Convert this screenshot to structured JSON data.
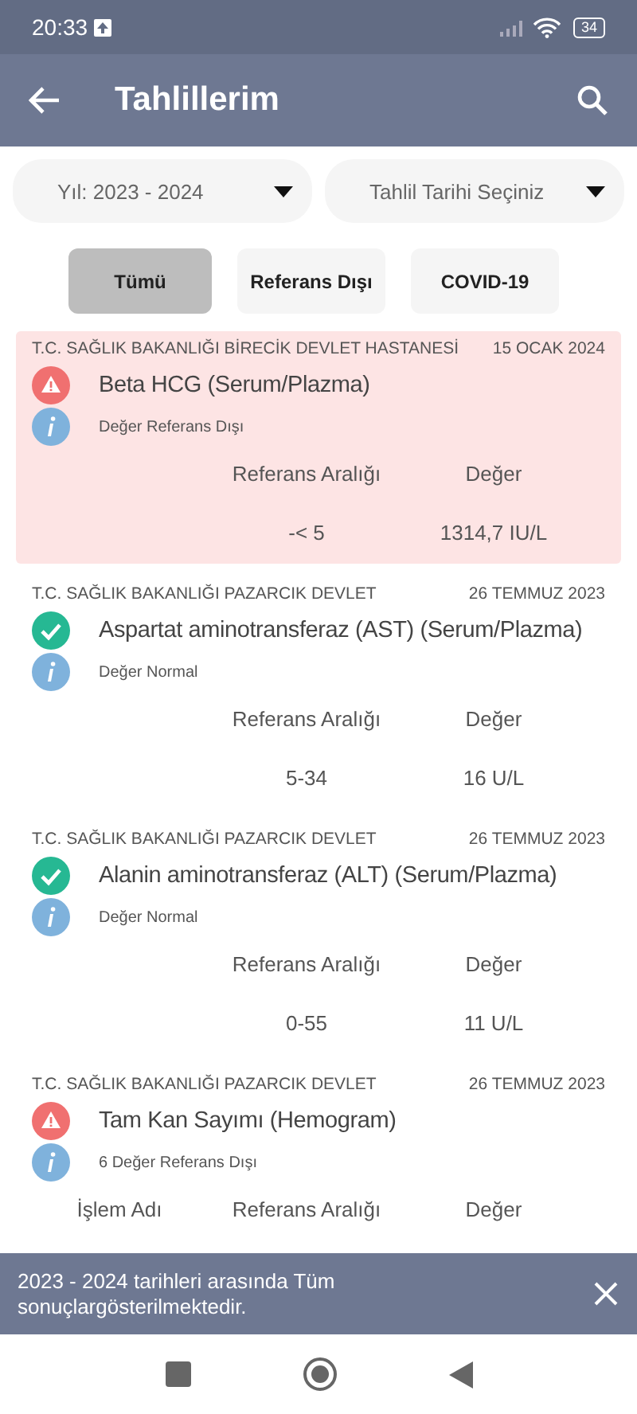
{
  "status_bar": {
    "time": "20:33",
    "battery": "34"
  },
  "app_bar": {
    "title": "Tahlillerim"
  },
  "filters": [
    {
      "label": "Yıl: 2023 - 2024"
    },
    {
      "label": "Tahlil Tarihi Seçiniz"
    }
  ],
  "tabs": [
    {
      "label": "Tümü",
      "selected": true
    },
    {
      "label": "Referans Dışı",
      "selected": false
    },
    {
      "label": "COVID-19",
      "selected": false
    }
  ],
  "results": [
    {
      "hospital": "T.C. SAĞLIK BAKANLIĞI BİRECİK DEVLET HASTANESİ",
      "date": "15 OCAK 2024",
      "kind": "abnormal",
      "highlighted": true,
      "test": "Beta HCG (Serum/Plazma)",
      "note": "Değer Referans Dışı",
      "columns": [
        "Referans Aralığı",
        "Değer"
      ],
      "values": [
        "-< 5",
        "1314,7 IU/L"
      ]
    },
    {
      "hospital": "T.C. SAĞLIK BAKANLIĞI PAZARCIK DEVLET",
      "date": "26 TEMMUZ 2023",
      "kind": "normal",
      "highlighted": false,
      "test": "Aspartat aminotransferaz (AST) (Serum/Plazma)",
      "note": "Değer Normal",
      "columns": [
        "Referans Aralığı",
        "Değer"
      ],
      "values": [
        "5-34",
        "16 U/L"
      ]
    },
    {
      "hospital": "T.C. SAĞLIK BAKANLIĞI PAZARCIK DEVLET",
      "date": "26 TEMMUZ 2023",
      "kind": "normal",
      "highlighted": false,
      "test": "Alanin aminotransferaz (ALT) (Serum/Plazma)",
      "note": "Değer Normal",
      "columns": [
        "Referans Aralığı",
        "Değer"
      ],
      "values": [
        "0-55",
        "11 U/L"
      ]
    },
    {
      "hospital": "T.C. SAĞLIK BAKANLIĞI PAZARCIK DEVLET",
      "date": "26 TEMMUZ 2023",
      "kind": "abnormal",
      "highlighted": false,
      "test": "Tam Kan Sayımı (Hemogram)",
      "note": "6 Değer Referans Dışı",
      "columns": [
        "İşlem Adı",
        "Referans Aralığı",
        "Değer"
      ]
    }
  ],
  "snackbar": {
    "message": "2023 - 2024 tarihleri arasında Tüm sonuçlargösterilmektedir."
  }
}
